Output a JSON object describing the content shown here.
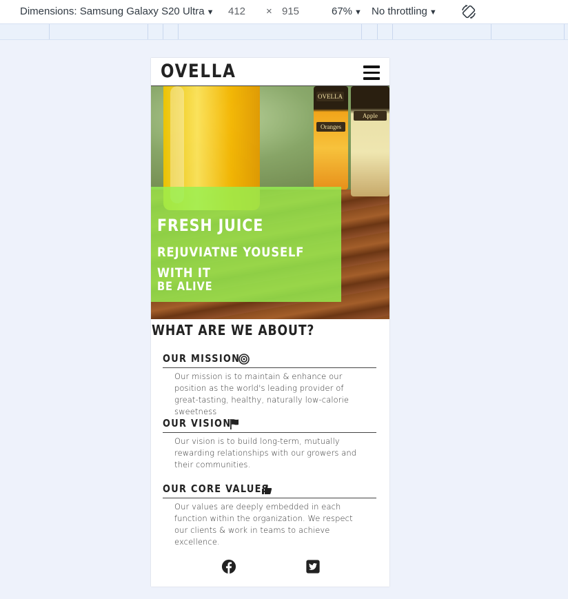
{
  "devtools": {
    "dimensions_label": "Dimensions: Samsung Galaxy S20 Ultra",
    "width": "412",
    "times": "×",
    "height": "915",
    "zoom": "67%",
    "throttling": "No throttling",
    "rotate_icon": "rotate-icon"
  },
  "site": {
    "logo": "OVELLA",
    "menu_icon": "hamburger-icon",
    "hero": {
      "title": "FRESH JUICE",
      "subtitle": "REJUVIATNE YOUSELF WITH IT",
      "tagline": "BE ALIVE",
      "bottle_labels": [
        "OVELLA",
        "Oranges",
        "Apple"
      ]
    },
    "about": {
      "title": "WHAT ARE WE ABOUT?",
      "sections": [
        {
          "heading": "OUR MISSION",
          "icon": "bullseye-icon",
          "text": "Our mission is to maintain & enhance our position as the world's leading provider of great-tasting, healthy, naturally low-calorie sweetness"
        },
        {
          "heading": "OUR VISION",
          "icon": "flag-icon",
          "text": "Our vision is to build long-term, mutually rewarding relationships with our growers and their communities."
        },
        {
          "heading": "OUR CORE VALUES",
          "icon": "thumbs-up-icon",
          "text": "Our values are deeply embedded in each function within the organization. We respect our clients & work in teams to achieve excellence."
        }
      ]
    },
    "social": [
      "facebook-icon",
      "twitter-icon"
    ],
    "colors": {
      "overlay": "#96f050",
      "text_dark": "#222222",
      "page_bg": "#eef2fb"
    }
  }
}
